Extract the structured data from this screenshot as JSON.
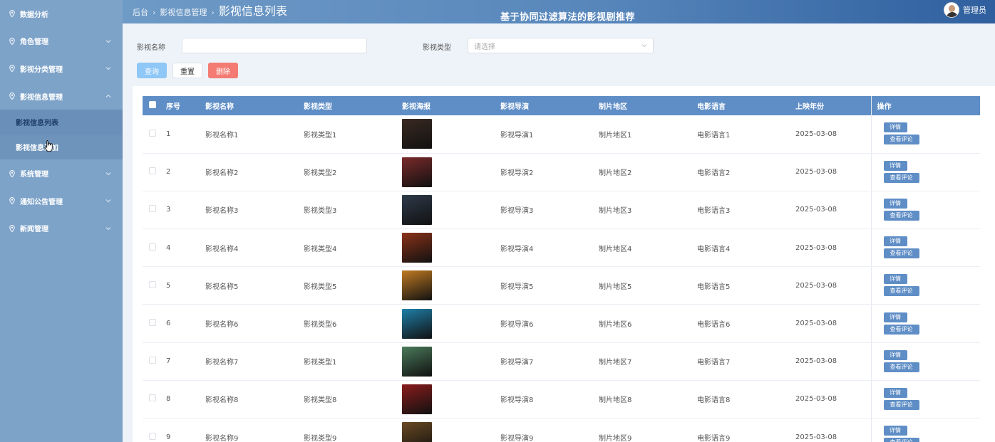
{
  "sidebar": {
    "items": [
      {
        "label": "数据分析"
      },
      {
        "label": "角色管理"
      },
      {
        "label": "影视分类管理"
      },
      {
        "label": "影视信息管理"
      },
      {
        "label": "系统管理"
      },
      {
        "label": "通知公告管理"
      },
      {
        "label": "新闻管理"
      }
    ],
    "sub": [
      {
        "label": "影视信息列表"
      },
      {
        "label": "影视信息添加"
      }
    ]
  },
  "header": {
    "breadcrumb": [
      "后台",
      "影视信息管理",
      "影视信息列表"
    ],
    "site_title": "基于协同过滤算法的影视剧推荐",
    "user": "管理员"
  },
  "filters": {
    "name_label": "影视名称",
    "name_value": "",
    "type_label": "影视类型",
    "type_placeholder": "请选择",
    "query": "查询",
    "reset": "重置",
    "delete": "删除"
  },
  "table": {
    "headers": [
      "序号",
      "影视名称",
      "影视类型",
      "影视海报",
      "影视导演",
      "制片地区",
      "电影语言",
      "上映年份",
      "操作"
    ],
    "detail_label": "详情",
    "comment_label": "查看评论",
    "rows": [
      {
        "no": "1",
        "name": "影视名称1",
        "type": "影视类型1",
        "poster": "#3a2a22",
        "director": "影视导演1",
        "region": "制片地区1",
        "lang": "电影语言1",
        "year": "2025-03-08"
      },
      {
        "no": "2",
        "name": "影视名称2",
        "type": "影视类型2",
        "poster": "#7a2a2a",
        "director": "影视导演2",
        "region": "制片地区2",
        "lang": "电影语言2",
        "year": "2025-03-08"
      },
      {
        "no": "3",
        "name": "影视名称3",
        "type": "影视类型3",
        "poster": "#2e3a4a",
        "director": "影视导演3",
        "region": "制片地区3",
        "lang": "电影语言3",
        "year": "2025-03-08"
      },
      {
        "no": "4",
        "name": "影视名称4",
        "type": "影视类型4",
        "poster": "#8a3218",
        "director": "影视导演4",
        "region": "制片地区4",
        "lang": "电影语言4",
        "year": "2025-03-08"
      },
      {
        "no": "5",
        "name": "影视名称5",
        "type": "影视类型5",
        "poster": "#c07a22",
        "director": "影视导演5",
        "region": "制片地区5",
        "lang": "电影语言5",
        "year": "2025-03-08"
      },
      {
        "no": "6",
        "name": "影视名称6",
        "type": "影视类型6",
        "poster": "#1f7fa8",
        "director": "影视导演6",
        "region": "制片地区6",
        "lang": "电影语言6",
        "year": "2025-03-08"
      },
      {
        "no": "7",
        "name": "影视名称7",
        "type": "影视类型1",
        "poster": "#4a7a5a",
        "director": "影视导演7",
        "region": "制片地区7",
        "lang": "电影语言7",
        "year": "2025-03-08"
      },
      {
        "no": "8",
        "name": "影视名称8",
        "type": "影视类型8",
        "poster": "#8a1c1c",
        "director": "影视导演8",
        "region": "制片地区8",
        "lang": "电影语言8",
        "year": "2025-03-08"
      },
      {
        "no": "9",
        "name": "影视名称9",
        "type": "影视类型9",
        "poster": "#6a4a22",
        "director": "影视导演9",
        "region": "制片地区9",
        "lang": "电影语言9",
        "year": "2025-03-08"
      }
    ]
  }
}
